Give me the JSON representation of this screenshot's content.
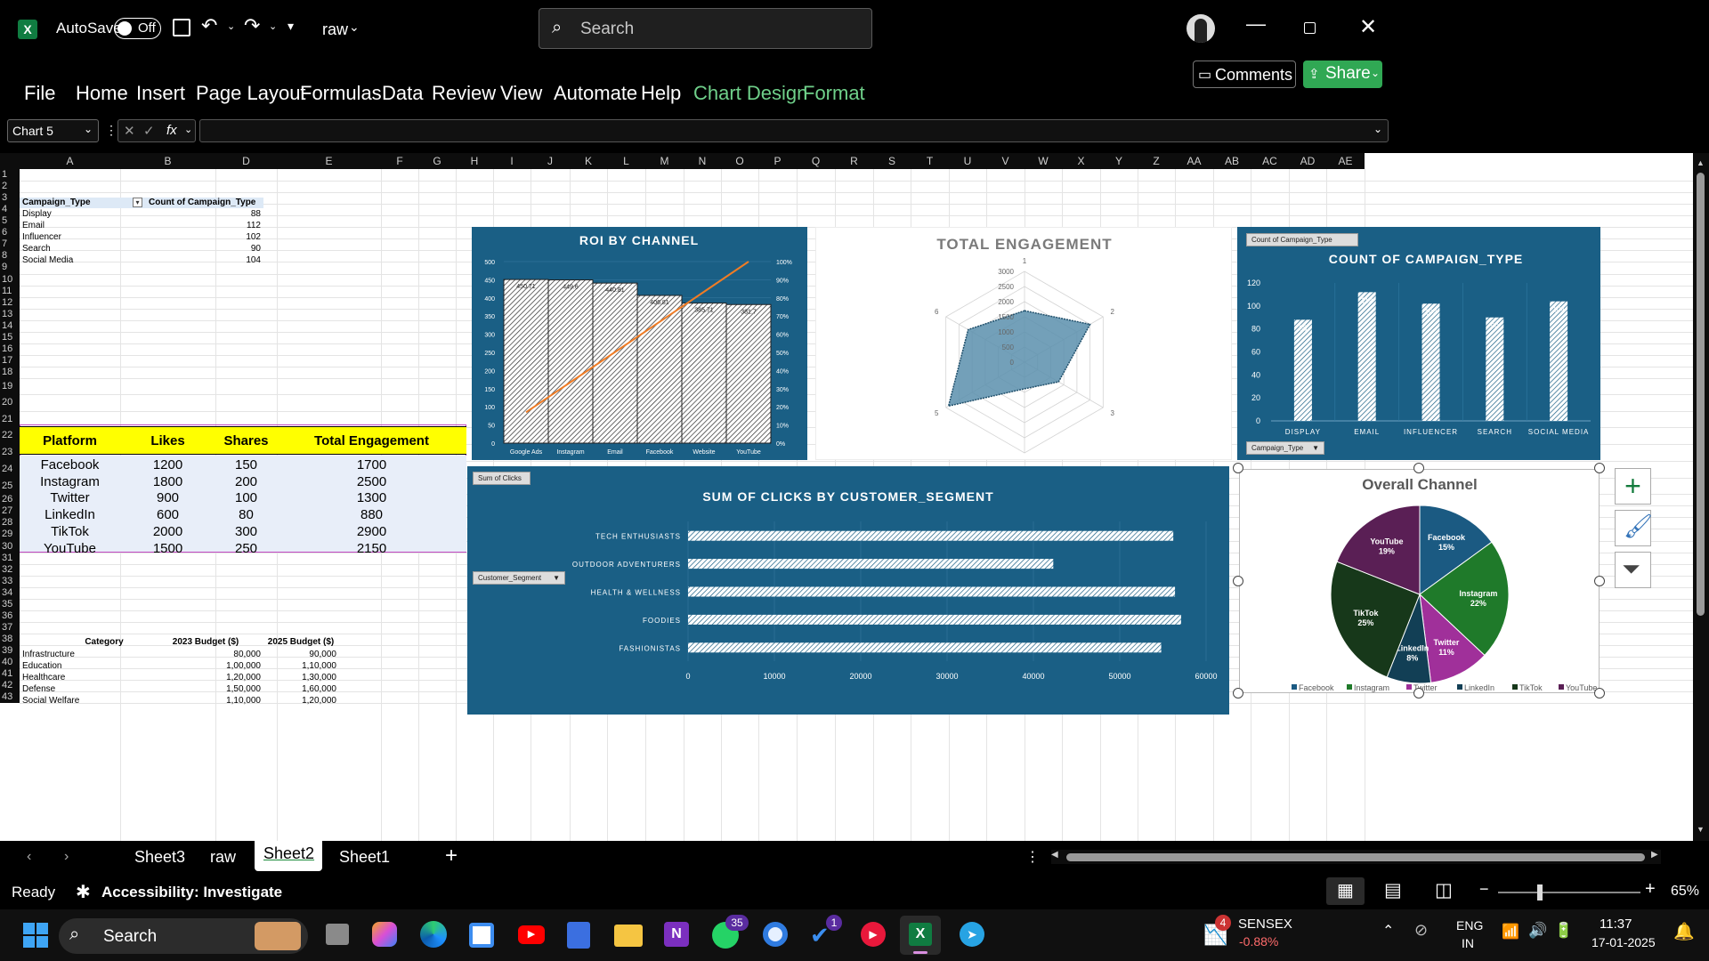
{
  "app": {
    "autosave_label": "AutoSave",
    "autosave_state": "Off",
    "filename": "raw",
    "search_placeholder": "Search"
  },
  "ribbon": {
    "tabs": [
      "File",
      "Home",
      "Insert",
      "Page Layout",
      "Formulas",
      "Data",
      "Review",
      "View",
      "Automate",
      "Help",
      "Chart Design",
      "Format"
    ],
    "comments": "Comments",
    "share": "Share"
  },
  "formula_bar": {
    "name_box": "Chart 5",
    "fx": "fx"
  },
  "columns": [
    "A",
    "B",
    "D",
    "E",
    "F",
    "G",
    "H",
    "I",
    "J",
    "K",
    "L",
    "M",
    "N",
    "O",
    "P",
    "Q",
    "R",
    "S",
    "T",
    "U",
    "V",
    "W",
    "X",
    "Y",
    "Z",
    "AA",
    "AB",
    "AC",
    "AD",
    "AE"
  ],
  "rows": [
    "1",
    "2",
    "3",
    "4",
    "5",
    "6",
    "7",
    "8",
    "9",
    "10",
    "11",
    "12",
    "13",
    "14",
    "15",
    "16",
    "17",
    "18",
    "19",
    "20",
    "21",
    "22",
    "23",
    "24",
    "25",
    "26",
    "27",
    "28",
    "29",
    "30",
    "31",
    "32",
    "33",
    "34",
    "35",
    "36",
    "37",
    "38",
    "39",
    "40",
    "41",
    "42",
    "43"
  ],
  "pivot_campaign": {
    "h1": "Campaign_Type",
    "h2": "Count of Campaign_Type",
    "rows": [
      [
        "Display",
        "88"
      ],
      [
        "Email",
        "112"
      ],
      [
        "Influencer",
        "102"
      ],
      [
        "Search",
        "90"
      ],
      [
        "Social Media",
        "104"
      ]
    ]
  },
  "platform_table": {
    "headers": [
      "Platform",
      "Likes",
      "Shares",
      "Total Engagement"
    ],
    "rows": [
      [
        "Facebook",
        "1200",
        "150",
        "1700"
      ],
      [
        "Instagram",
        "1800",
        "200",
        "2500"
      ],
      [
        "Twitter",
        "900",
        "100",
        "1300"
      ],
      [
        "LinkedIn",
        "600",
        "80",
        "880"
      ],
      [
        "TikTok",
        "2000",
        "300",
        "2900"
      ],
      [
        "YouTube",
        "1500",
        "250",
        "2150"
      ]
    ]
  },
  "budget_table": {
    "headers": [
      "Category",
      "2023 Budget ($)",
      "2025 Budget ($)"
    ],
    "rows": [
      [
        "Infrastructure",
        "80,000",
        "90,000"
      ],
      [
        "Education",
        "1,00,000",
        "1,10,000"
      ],
      [
        "Healthcare",
        "1,20,000",
        "1,30,000"
      ],
      [
        "Defense",
        "1,50,000",
        "1,60,000"
      ],
      [
        "Social Welfare",
        "1,10,000",
        "1,20,000"
      ]
    ]
  },
  "colors": {
    "chart_bg": "#1a5f85",
    "header_yellow": "#ffff00",
    "excel_green": "#107c41",
    "accent_orange": "#f07c25"
  },
  "chart_data": [
    {
      "type": "bar",
      "title": "ROI BY CHANNEL",
      "categories": [
        "Google Ads",
        "Instagram",
        "Email",
        "Facebook",
        "Website",
        "YouTube"
      ],
      "values": [
        450.71,
        449.6,
        440.81,
        406.81,
        385.71,
        381.7
      ],
      "ylim": [
        0,
        500
      ],
      "yticks": [
        "0",
        "50",
        "100",
        "150",
        "200",
        "250",
        "300",
        "350",
        "400",
        "450",
        "500"
      ],
      "y2ticks": [
        "0%",
        "10%",
        "20%",
        "30%",
        "40%",
        "50%",
        "60%",
        "70%",
        "80%",
        "90%",
        "100%"
      ]
    },
    {
      "type": "radar",
      "title": "TOTAL ENGAGEMENT",
      "axes": [
        "1",
        "2",
        "3",
        "4",
        "5",
        "6"
      ],
      "values": [
        1700,
        2500,
        1300,
        880,
        2900,
        2150
      ],
      "ticks": [
        "0",
        "500",
        "1000",
        "1500",
        "2000",
        "2500",
        "3000"
      ]
    },
    {
      "type": "bar",
      "title": "COUNT OF CAMPAIGN_TYPE",
      "categories": [
        "DISPLAY",
        "EMAIL",
        "INFLUENCER",
        "SEARCH",
        "SOCIAL MEDIA"
      ],
      "values": [
        88,
        112,
        102,
        90,
        104
      ],
      "ylim": [
        0,
        120
      ],
      "yticks": [
        "0",
        "20",
        "40",
        "60",
        "80",
        "100",
        "120"
      ],
      "field_button": "Count of Campaign_Type",
      "filter_button": "Campaign_Type"
    },
    {
      "type": "bar",
      "title": "SUM OF CLICKS BY CUSTOMER_SEGMENT",
      "categories": [
        "TECH ENTHUSIASTS",
        "OUTDOOR ADVENTURERS",
        "HEALTH & WELLNESS",
        "FOODIES",
        "FASHIONISTAS"
      ],
      "values": [
        56200,
        42300,
        56400,
        57100,
        54800
      ],
      "xticks": [
        "0",
        "10000",
        "20000",
        "30000",
        "40000",
        "50000",
        "60000"
      ],
      "field_button": "Sum of Clicks",
      "filter_button": "Customer_Segment"
    },
    {
      "type": "pie",
      "title": "Overall Channel",
      "categories": [
        "Facebook",
        "Instagram",
        "Twitter",
        "LinkedIn",
        "TikTok",
        "YouTube"
      ],
      "values": [
        15,
        22,
        11,
        8,
        25,
        19
      ],
      "labels": [
        "15%",
        "22%",
        "11%",
        "8%",
        "25%",
        "19%"
      ],
      "colors": [
        "#1b5a82",
        "#1f7a2a",
        "#a0309a",
        "#123f55",
        "#17381a",
        "#5a1f55"
      ]
    }
  ],
  "sheets": [
    "Sheet3",
    "raw",
    "Sheet2",
    "Sheet1"
  ],
  "status": {
    "ready": "Ready",
    "accessibility": "Accessibility: Investigate",
    "zoom": "65%"
  },
  "taskbar": {
    "search": "Search",
    "whatsapp_badge": "35",
    "todo_badge": "1",
    "sensex_badge": "4",
    "sensex": "SENSEX",
    "sensex_change": "-0.88%",
    "lang1": "ENG",
    "lang2": "IN",
    "time": "11:37",
    "date": "17-01-2025"
  }
}
